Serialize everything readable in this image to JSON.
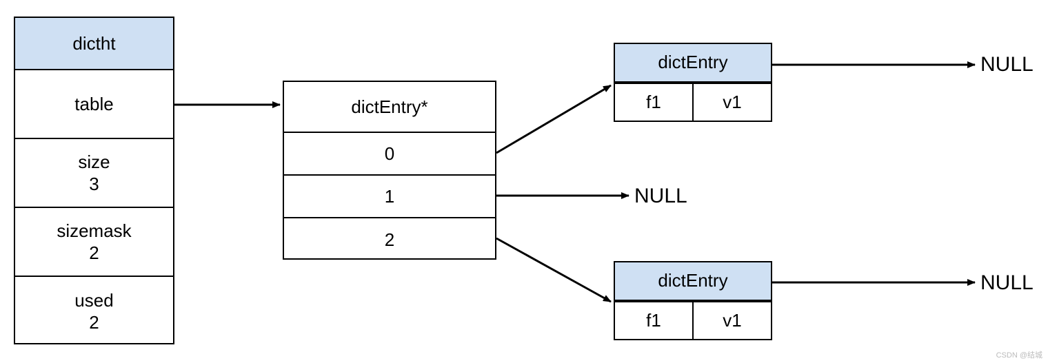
{
  "dictht": {
    "title": "dictht",
    "rows": [
      {
        "label": "table"
      },
      {
        "label": "size",
        "value": "3"
      },
      {
        "label": "sizemask",
        "value": "2"
      },
      {
        "label": "used",
        "value": "2"
      }
    ]
  },
  "bucket": {
    "title": "dictEntry*",
    "slots": [
      "0",
      "1",
      "2"
    ]
  },
  "entry_top": {
    "title": "dictEntry",
    "key": "f1",
    "val": "v1"
  },
  "entry_bottom": {
    "title": "dictEntry",
    "key": "f1",
    "val": "v1"
  },
  "nulls": {
    "top": "NULL",
    "mid": "NULL",
    "bottom": "NULL"
  },
  "watermark": "CSDN @结城"
}
